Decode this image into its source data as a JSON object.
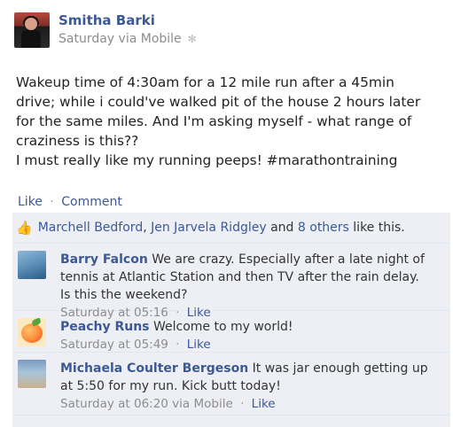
{
  "post": {
    "author": "Smitha Barki",
    "timestamp": "Saturday via Mobile",
    "body_lines": [
      "Wakeup time of 4:30am for a 12 mile run after a 45min",
      "drive; while i could've walked pit of the house 2 hours later",
      "for the same miles. And I'm asking myself - what range of",
      "craziness is this??",
      "I must really like my running peeps! #marathontraining"
    ]
  },
  "actions": {
    "like": "Like",
    "separator": "·",
    "comment": "Comment"
  },
  "likes": {
    "person1": "Marchell Bedford",
    "comma": ",",
    "person2": "Jen Jarvela Ridgley",
    "and": "and",
    "others": "8 others",
    "suffix": "like this."
  },
  "comments": [
    {
      "name": "Barry Falcon",
      "text_lines": [
        "We are crazy. Especially after a late night of",
        "tennis at Atlantic Station and then TV after the rain delay.",
        "Is this the weekend?"
      ],
      "time": "Saturday at 05:16",
      "like": "Like"
    },
    {
      "name": "Peachy Runs",
      "text_lines": [
        "Welcome to my world!"
      ],
      "time": "Saturday at 05:49",
      "like": "Like"
    },
    {
      "name": "Michaela Coulter Bergeson",
      "text_lines": [
        "It was jar enough getting up",
        "at 5:50 for my run. Kick butt today!"
      ],
      "time": "Saturday at 06:20 via Mobile",
      "like": "Like"
    }
  ],
  "icons": {
    "privacy": "gear-icon",
    "like": "thumbs-up-icon"
  },
  "colors": {
    "link": "#3b5998",
    "feedback_bg": "#edeff4",
    "meta_text": "#8d8d8d"
  }
}
